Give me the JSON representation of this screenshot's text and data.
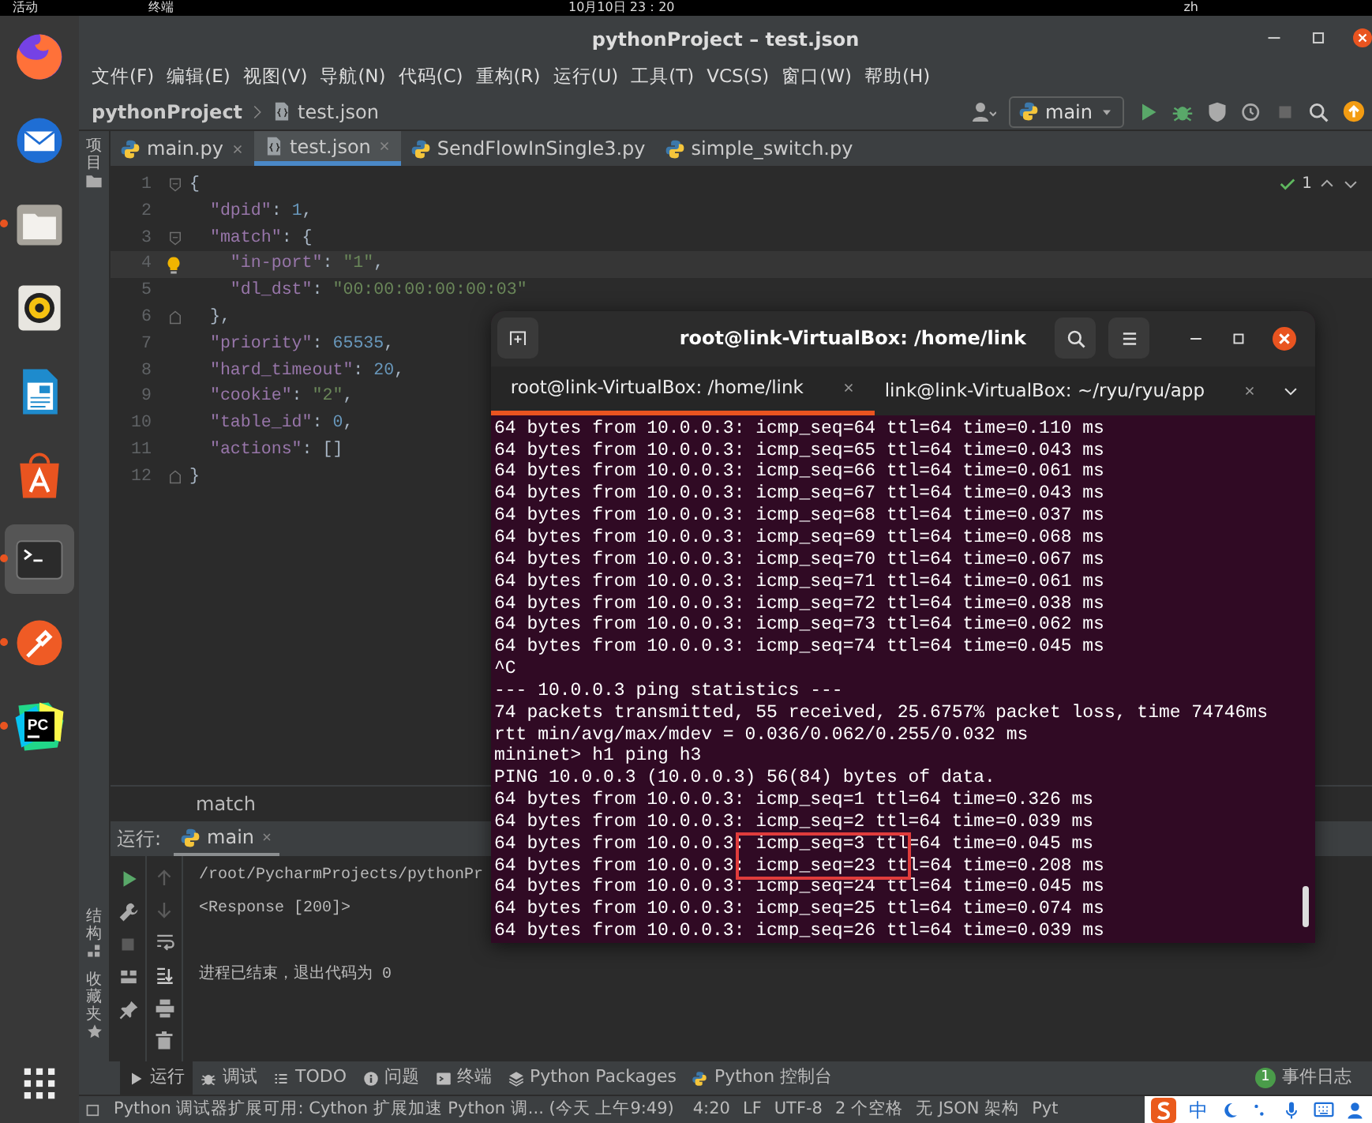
{
  "top_bar": {
    "activities": "活动",
    "app_menu": "终端",
    "clock": "10月10日 23：20",
    "input_method": "zh"
  },
  "dock": [
    {
      "kind": "browser",
      "running": false,
      "active": false
    },
    {
      "kind": "mail",
      "running": false,
      "active": false
    },
    {
      "kind": "files",
      "running": true,
      "active": false
    },
    {
      "kind": "music",
      "running": false,
      "active": false
    },
    {
      "kind": "document",
      "running": false,
      "active": false
    },
    {
      "kind": "store",
      "running": false,
      "active": false
    },
    {
      "kind": "terminal",
      "running": true,
      "active": true
    },
    {
      "kind": "pen",
      "running": true,
      "active": false
    },
    {
      "kind": "ide",
      "running": true,
      "active": false,
      "logo_text": "PC"
    }
  ],
  "ide": {
    "title": "pythonProject – test.json",
    "menu": [
      "文件(F)",
      "编辑(E)",
      "视图(V)",
      "导航(N)",
      "代码(C)",
      "重构(R)",
      "运行(U)",
      "工具(T)",
      "VCS(S)",
      "窗口(W)",
      "帮助(H)"
    ],
    "breadcrumb": [
      "pythonProject",
      "test.json"
    ],
    "run_config": "main",
    "tabs": [
      {
        "label": "main.py",
        "kind": "python",
        "selected": false
      },
      {
        "label": "test.json",
        "kind": "json",
        "selected": true
      },
      {
        "label": "SendFlowInSingle3.py",
        "kind": "python",
        "selected": false
      },
      {
        "label": "simple_switch.py",
        "kind": "python",
        "selected": false
      }
    ],
    "inspection_count": "1",
    "editor": {
      "lines": [
        {
          "number": "1",
          "fold_open": true,
          "tokens": [
            {
              "text": "{",
              "kind": "punct"
            }
          ]
        },
        {
          "number": "2",
          "tokens": [
            {
              "text": "  \"dpid\"",
              "kind": "key"
            },
            {
              "text": ": ",
              "kind": "punct"
            },
            {
              "text": "1",
              "kind": "number"
            },
            {
              "text": ",",
              "kind": "punct"
            }
          ]
        },
        {
          "number": "3",
          "fold_open": true,
          "tokens": [
            {
              "text": "  \"match\"",
              "kind": "key"
            },
            {
              "text": ": {",
              "kind": "punct"
            }
          ]
        },
        {
          "number": "4",
          "current": true,
          "hint": true,
          "tokens": [
            {
              "text": "    \"in-port\"",
              "kind": "key"
            },
            {
              "text": ": ",
              "kind": "punct"
            },
            {
              "text": "\"1\"",
              "kind": "string"
            },
            {
              "text": ",",
              "kind": "punct"
            }
          ]
        },
        {
          "number": "5",
          "tokens": [
            {
              "text": "    \"dl_dst\"",
              "kind": "key"
            },
            {
              "text": ": ",
              "kind": "punct"
            },
            {
              "text": "\"00:00:00:00:00:03\"",
              "kind": "string"
            }
          ]
        },
        {
          "number": "6",
          "fold_close": true,
          "tokens": [
            {
              "text": "  },",
              "kind": "punct"
            }
          ]
        },
        {
          "number": "7",
          "tokens": [
            {
              "text": "  \"priority\"",
              "kind": "key"
            },
            {
              "text": ": ",
              "kind": "punct"
            },
            {
              "text": "65535",
              "kind": "number"
            },
            {
              "text": ",",
              "kind": "punct"
            }
          ]
        },
        {
          "number": "8",
          "tokens": [
            {
              "text": "  \"hard_timeout\"",
              "kind": "key"
            },
            {
              "text": ": ",
              "kind": "punct"
            },
            {
              "text": "20",
              "kind": "number"
            },
            {
              "text": ",",
              "kind": "punct"
            }
          ]
        },
        {
          "number": "9",
          "tokens": [
            {
              "text": "  \"cookie\"",
              "kind": "key"
            },
            {
              "text": ": ",
              "kind": "punct"
            },
            {
              "text": "\"2\"",
              "kind": "string"
            },
            {
              "text": ",",
              "kind": "punct"
            }
          ]
        },
        {
          "number": "10",
          "tokens": [
            {
              "text": "  \"table_id\"",
              "kind": "key"
            },
            {
              "text": ": ",
              "kind": "punct"
            },
            {
              "text": "0",
              "kind": "number"
            },
            {
              "text": ",",
              "kind": "punct"
            }
          ]
        },
        {
          "number": "11",
          "tokens": [
            {
              "text": "  \"actions\"",
              "kind": "key"
            },
            {
              "text": ": []",
              "kind": "punct"
            }
          ]
        },
        {
          "number": "12",
          "fold_close": true,
          "tokens": [
            {
              "text": "}",
              "kind": "punct"
            }
          ]
        }
      ]
    },
    "path": "match",
    "tool_strip": {
      "top": "项目",
      "bottom": [
        "结构",
        "收藏夹"
      ]
    },
    "run": {
      "label": "运行:",
      "tab": {
        "label": "main",
        "selected": true
      },
      "output_blocks": [
        [
          "/root/PycharmProjects/pythonPr",
          "<Response [200]>"
        ],
        [
          "进程已结束，退出代码为 0"
        ]
      ]
    },
    "tool_tabs": [
      {
        "label": "运行",
        "kind": "run",
        "selected": true
      },
      {
        "label": "调试",
        "kind": "debug",
        "selected": false
      },
      {
        "label": "TODO",
        "kind": "todo",
        "selected": false
      },
      {
        "label": "问题",
        "kind": "problems",
        "selected": false
      },
      {
        "label": "终端",
        "kind": "terminal",
        "selected": false
      },
      {
        "label": "Python Packages",
        "kind": "packages",
        "selected": false
      },
      {
        "label": "Python 控制台",
        "kind": "console",
        "selected": false
      }
    ],
    "event_log": {
      "count": "1",
      "label": "事件日志"
    },
    "status": {
      "message": "Python 调试器扩展可用: Cython 扩展加速 Python 调... (今天 上午9:49)",
      "items": [
        "4:20",
        "LF",
        "UTF-8",
        "2 个空格",
        "无 JSON 架构",
        "Pyt"
      ]
    }
  },
  "ime": {
    "mode": "中"
  },
  "terminal": {
    "title": "root@link-VirtualBox: /home/link",
    "tabs": [
      {
        "label": "root@link-VirtualBox: /home/link",
        "selected": true
      },
      {
        "label": "link@link-VirtualBox: ~/ryu/ryu/app",
        "selected": false
      }
    ],
    "lines": [
      {
        "text": "64 bytes from 10.0.0.3: icmp_seq=64 ttl=64 time=0.110 ms",
        "highlighted": false
      },
      {
        "text": "64 bytes from 10.0.0.3: icmp_seq=65 ttl=64 time=0.043 ms",
        "highlighted": false
      },
      {
        "text": "64 bytes from 10.0.0.3: icmp_seq=66 ttl=64 time=0.061 ms",
        "highlighted": false
      },
      {
        "text": "64 bytes from 10.0.0.3: icmp_seq=67 ttl=64 time=0.043 ms",
        "highlighted": false
      },
      {
        "text": "64 bytes from 10.0.0.3: icmp_seq=68 ttl=64 time=0.037 ms",
        "highlighted": false
      },
      {
        "text": "64 bytes from 10.0.0.3: icmp_seq=69 ttl=64 time=0.068 ms",
        "highlighted": false
      },
      {
        "text": "64 bytes from 10.0.0.3: icmp_seq=70 ttl=64 time=0.067 ms",
        "highlighted": false
      },
      {
        "text": "64 bytes from 10.0.0.3: icmp_seq=71 ttl=64 time=0.061 ms",
        "highlighted": false
      },
      {
        "text": "64 bytes from 10.0.0.3: icmp_seq=72 ttl=64 time=0.038 ms",
        "highlighted": false
      },
      {
        "text": "64 bytes from 10.0.0.3: icmp_seq=73 ttl=64 time=0.062 ms",
        "highlighted": false
      },
      {
        "text": "64 bytes from 10.0.0.3: icmp_seq=74 ttl=64 time=0.045 ms",
        "highlighted": false
      },
      {
        "text": "^C",
        "highlighted": false
      },
      {
        "text": "--- 10.0.0.3 ping statistics ---",
        "highlighted": false
      },
      {
        "text": "74 packets transmitted, 55 received, 25.6757% packet loss, time 74746ms",
        "highlighted": false
      },
      {
        "text": "rtt min/avg/max/mdev = 0.036/0.062/0.255/0.032 ms",
        "highlighted": false
      },
      {
        "text": "mininet> h1 ping h3",
        "highlighted": false
      },
      {
        "text": "PING 10.0.0.3 (10.0.0.3) 56(84) bytes of data.",
        "highlighted": false
      },
      {
        "text": "64 bytes from 10.0.0.3: icmp_seq=1 ttl=64 time=0.326 ms",
        "highlighted": false
      },
      {
        "text": "64 bytes from 10.0.0.3: icmp_seq=2 ttl=64 time=0.039 ms",
        "highlighted": false
      },
      {
        "text": "64 bytes from 10.0.0.3: icmp_seq=3 ttl=64 time=0.045 ms",
        "highlighted": true
      },
      {
        "text": "64 bytes from 10.0.0.3: icmp_seq=23 ttl=64 time=0.208 ms",
        "highlighted": true
      },
      {
        "text": "64 bytes from 10.0.0.3: icmp_seq=24 ttl=64 time=0.045 ms",
        "highlighted": false
      },
      {
        "text": "64 bytes from 10.0.0.3: icmp_seq=25 ttl=64 time=0.074 ms",
        "highlighted": false
      },
      {
        "text": "64 bytes from 10.0.0.3: icmp_seq=26 ttl=64 time=0.039 ms",
        "highlighted": false
      }
    ]
  }
}
